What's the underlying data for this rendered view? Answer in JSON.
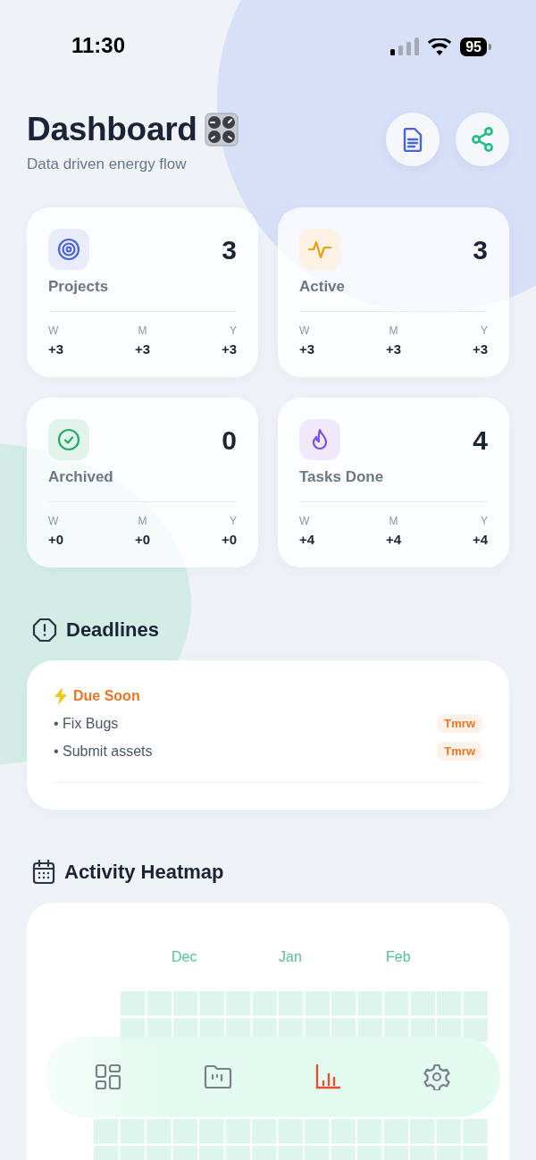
{
  "status_bar": {
    "time": "11:30",
    "battery": "95"
  },
  "header": {
    "title": "Dashboard",
    "subtitle": "Data driven energy flow"
  },
  "stats": [
    {
      "label": "Projects",
      "value": "3",
      "periods": [
        {
          "label": "W",
          "value": "+3"
        },
        {
          "label": "M",
          "value": "+3"
        },
        {
          "label": "Y",
          "value": "+3"
        }
      ]
    },
    {
      "label": "Active",
      "value": "3",
      "periods": [
        {
          "label": "W",
          "value": "+3"
        },
        {
          "label": "M",
          "value": "+3"
        },
        {
          "label": "Y",
          "value": "+3"
        }
      ]
    },
    {
      "label": "Archived",
      "value": "0",
      "periods": [
        {
          "label": "W",
          "value": "+0"
        },
        {
          "label": "M",
          "value": "+0"
        },
        {
          "label": "Y",
          "value": "+0"
        }
      ]
    },
    {
      "label": "Tasks Done",
      "value": "4",
      "periods": [
        {
          "label": "W",
          "value": "+4"
        },
        {
          "label": "M",
          "value": "+4"
        },
        {
          "label": "Y",
          "value": "+4"
        }
      ]
    }
  ],
  "deadlines": {
    "title": "Deadlines",
    "group": "Due Soon",
    "items": [
      {
        "text": "• Fix Bugs",
        "due": "Tmrw"
      },
      {
        "text": "• Submit assets",
        "due": "Tmrw"
      }
    ]
  },
  "heatmap": {
    "title": "Activity Heatmap",
    "months": [
      "Dec",
      "Jan",
      "Feb"
    ]
  },
  "tab_bar": [
    {
      "selected": false
    },
    {
      "selected": false
    },
    {
      "selected": true
    },
    {
      "selected": false
    }
  ]
}
